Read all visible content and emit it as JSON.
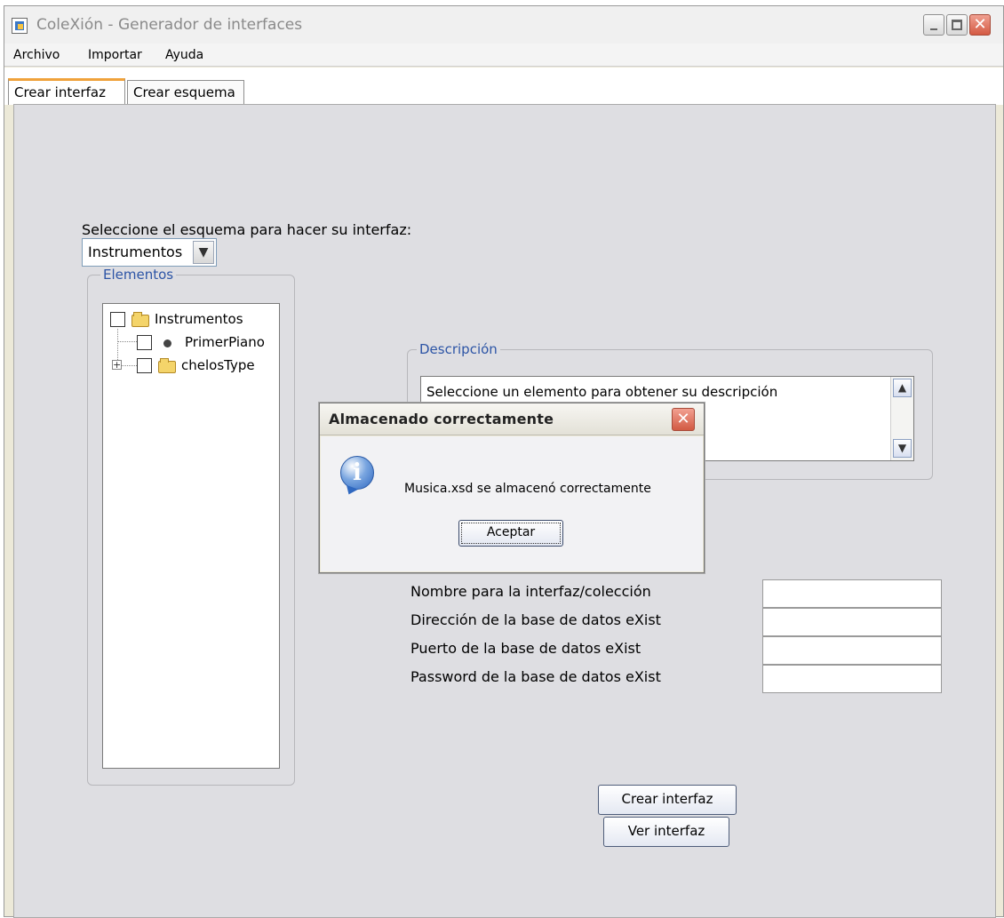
{
  "window": {
    "title": "ColeXión - Generador de interfaces"
  },
  "menu": {
    "archivo": "Archivo",
    "importar": "Importar",
    "ayuda": "Ayuda"
  },
  "tabs": [
    {
      "label": "Crear interfaz",
      "active": true
    },
    {
      "label": "Crear esquema",
      "active": false
    }
  ],
  "schema": {
    "label": "Seleccione el esquema para hacer su interfaz:",
    "selected": "Instrumentos"
  },
  "elementos": {
    "legend": "Elementos",
    "tree": [
      {
        "label": "Instrumentos",
        "type": "folder",
        "checked": false
      },
      {
        "label": "PrimerPiano",
        "type": "leaf",
        "checked": false
      },
      {
        "label": "chelosType",
        "type": "folder",
        "checked": false,
        "collapsed": true
      }
    ]
  },
  "descripcion": {
    "legend": "Descripción",
    "text": "Seleccione un elemento para obtener su descripción"
  },
  "form": {
    "labels": [
      "Nombre para la interfaz/colección",
      "Dirección de la base de datos eXist",
      "Puerto de la base de datos eXist",
      "Password de la base de datos eXist"
    ],
    "values": [
      "",
      "",
      "",
      ""
    ]
  },
  "buttons": {
    "crear_interfaz": "Crear interfaz",
    "ver_interfaz": "Ver interfaz"
  },
  "dialog": {
    "title": "Almacenado correctamente",
    "message": "Musica.xsd se almacenó correctamente",
    "ok": "Aceptar"
  },
  "icons": {
    "app": "java-cup-icon",
    "info": "info-icon",
    "close": "close-icon"
  },
  "colors": {
    "legend_text": "#2d55a6",
    "active_tab_accent": "#f0a23b",
    "close_button": "#d45a43",
    "panel_background": "#dedee2"
  }
}
